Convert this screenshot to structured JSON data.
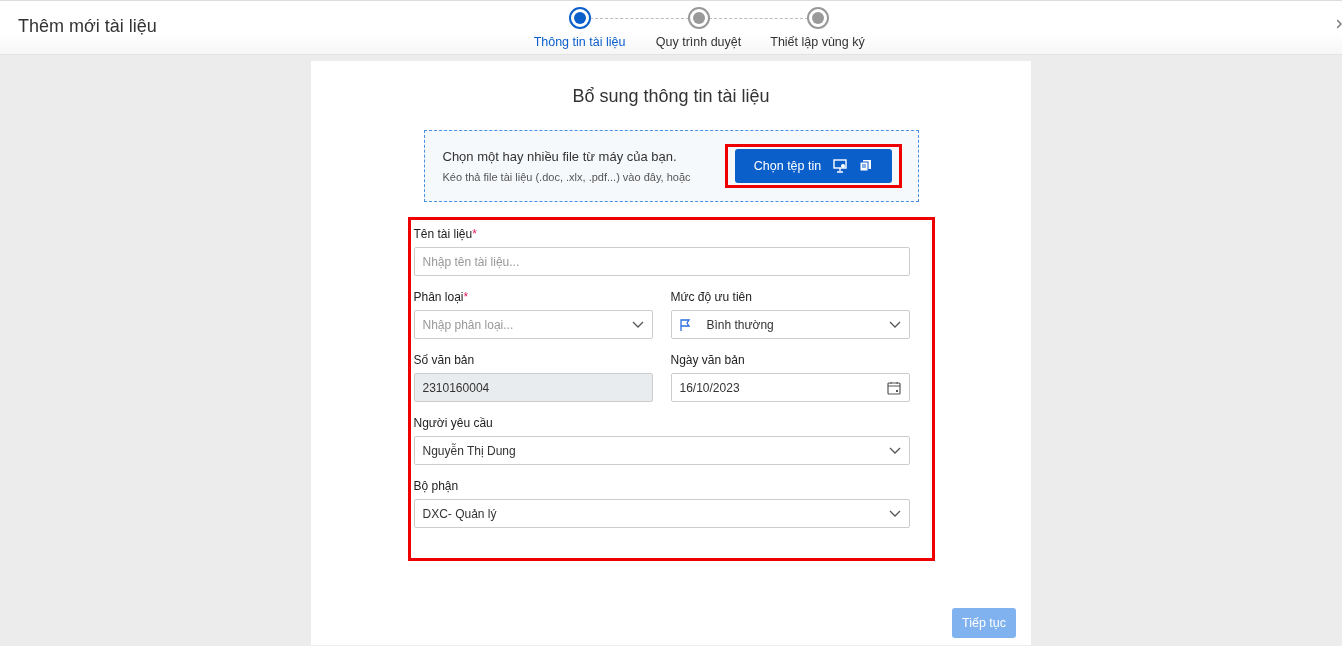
{
  "window": {
    "title": "Thêm mới tài liệu"
  },
  "steps": [
    {
      "label": "Thông tin tài liệu",
      "selected": true
    },
    {
      "label": "Quy trình duyệt",
      "selected": false
    },
    {
      "label": "Thiết lập vùng ký",
      "selected": false
    }
  ],
  "panel": {
    "title": "Bổ sung thông tin tài liệu",
    "upload": {
      "heading": "Chọn một hay nhiều file từ máy của bạn.",
      "hint": "Kéo thả file tài liệu (.doc, .xlx, .pdf...) vào đây, hoặc",
      "button": "Chọn tệp tin",
      "highlighted": true
    },
    "form": {
      "highlighted": true,
      "rows": [
        [
          {
            "kind": "text",
            "label": "Tên tài liệu",
            "required_mark": "*",
            "placeholder": "Nhập tên tài liệu..."
          }
        ],
        [
          {
            "kind": "select",
            "label": "Phân loại",
            "required_mark": "*",
            "placeholder": "Nhập phân loại..."
          },
          {
            "kind": "flag-select",
            "label": "Mức độ ưu tiên",
            "value": "Bình thường"
          }
        ],
        [
          {
            "kind": "readonly",
            "label": "Số văn bản",
            "value": "2310160004"
          },
          {
            "kind": "date",
            "label": "Ngày văn bản",
            "value": "16/10/2023"
          }
        ],
        [
          {
            "kind": "select",
            "label": "Người yêu cầu",
            "value": "Nguyễn Thị Dung"
          }
        ],
        [
          {
            "kind": "select",
            "label": "Bộ phận",
            "value": "DXC- Quản lý"
          }
        ]
      ]
    },
    "next_button": {
      "label": "Tiếp tục",
      "disabled": true
    }
  }
}
